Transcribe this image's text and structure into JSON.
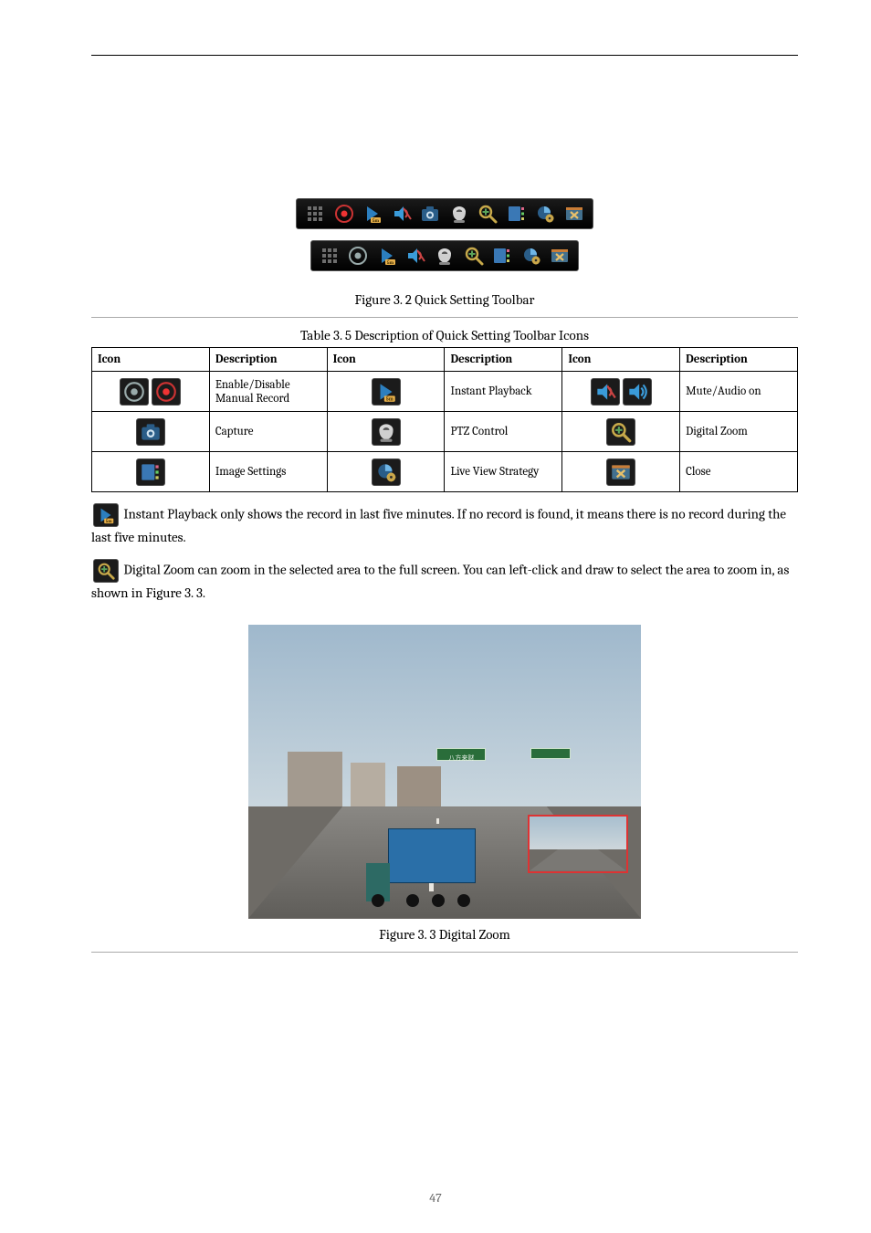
{
  "figure1_caption": "Figure 3. 2  Quick Setting Toolbar",
  "table_caption": "Table 3. 5  Description of Quick Setting Toolbar Icons",
  "table_headers": [
    "Icon",
    "Description",
    "Icon",
    "Description",
    "Icon",
    "Description"
  ],
  "table_rows": [
    {
      "c1_icon": "record-toggle-icon",
      "c1_desc": "Enable/Disable Manual Record",
      "c2_icon": "instant-playback-icon",
      "c2_desc": "Instant Playback",
      "c3_icon": "audio-toggle-icon",
      "c3_desc": "Mute/Audio on"
    },
    {
      "c1_icon": "capture-icon",
      "c1_desc": "Capture",
      "c2_icon": "ptz-control-icon",
      "c2_desc": "PTZ Control",
      "c3_icon": "digital-zoom-icon",
      "c3_desc": "Digital Zoom"
    },
    {
      "c1_icon": "image-settings-icon",
      "c1_desc": "Image Settings",
      "c2_icon": "live-strategy-icon",
      "c2_desc": "Live View Strategy",
      "c3_icon": "close-icon",
      "c3_desc": "Close"
    }
  ],
  "para_playback": {
    "prefix": "Instant Playback only shows the record in last five minutes. If no record is found, it means there is no record during the last five minutes.",
    "icon": "instant-playback-icon"
  },
  "para_zoom": {
    "prefix": "Digital Zoom can zoom in the selected area to the full screen. You can left-click and draw to select the area to zoom in, as shown in ",
    "ref": "Figure 3. 3",
    "suffix": ".",
    "icon": "digital-zoom-icon"
  },
  "sign_text": "八方来财",
  "figure2_caption": "Figure 3. 3  Digital Zoom",
  "page_number": "47"
}
